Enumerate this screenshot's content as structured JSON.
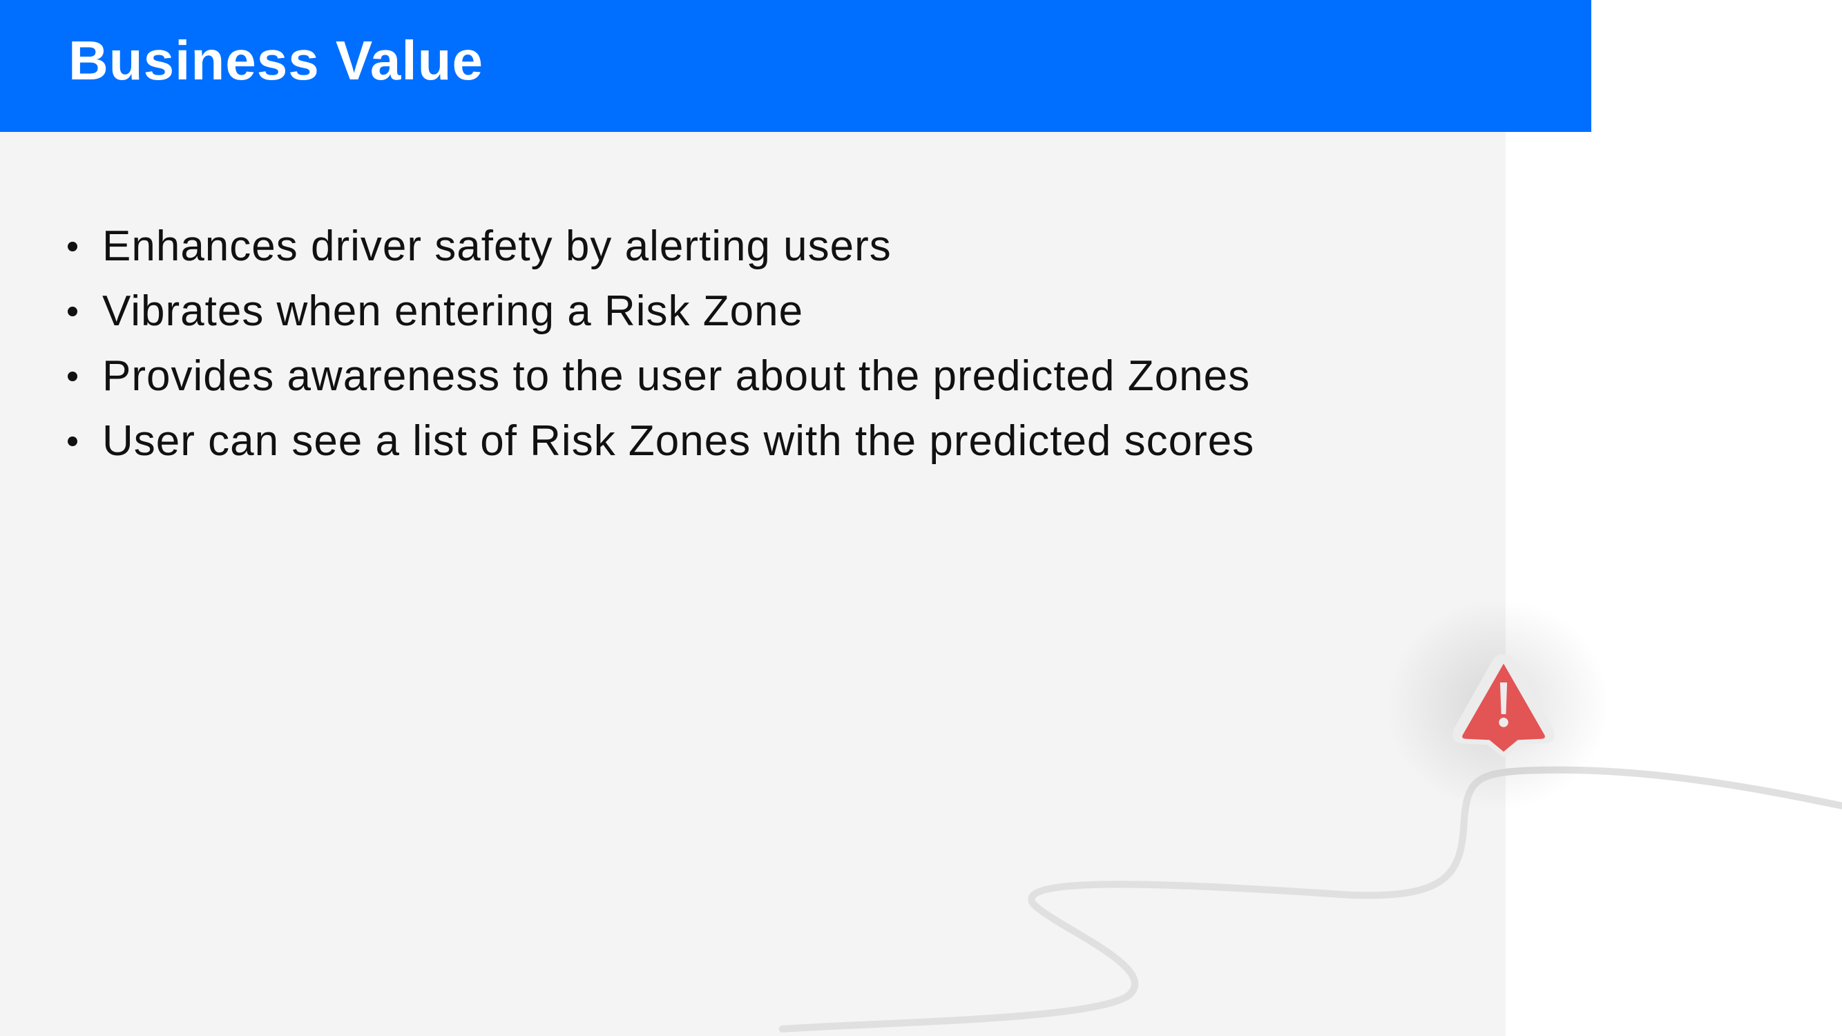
{
  "header": {
    "title": "Business Value"
  },
  "bullets": [
    "Enhances driver safety by alerting users",
    "Vibrates when entering a Risk Zone",
    "Provides awareness to the user about the predicted Zones",
    "User can see a list of Risk Zones with the predicted scores"
  ],
  "colors": {
    "header": "#006fff",
    "panel": "#f4f4f4",
    "alert": "#e35454",
    "road": "#e0e0e0"
  },
  "icons": [
    "warning-icon"
  ]
}
